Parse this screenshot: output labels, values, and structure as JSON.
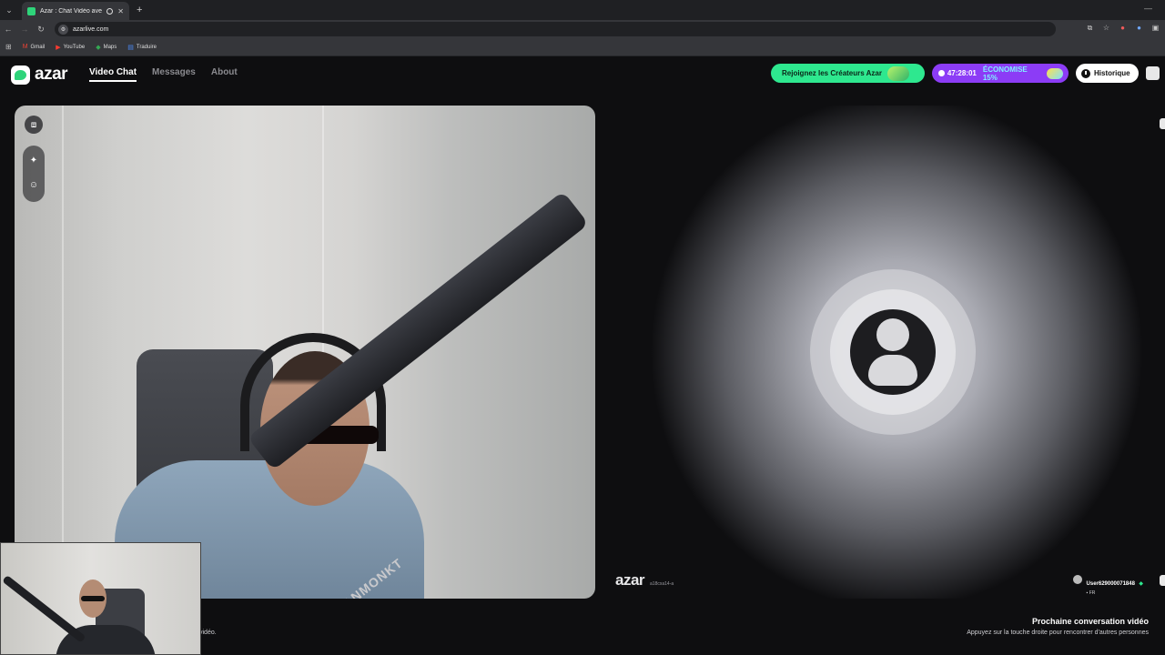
{
  "browser": {
    "tab_title": "Azar : Chat Vidéo avec de ...",
    "url": "azarlive.com",
    "bookmarks": [
      "Gmail",
      "YouTube",
      "Maps",
      "Traduire"
    ]
  },
  "header": {
    "logo": "azar",
    "nav": [
      {
        "label": "Video Chat",
        "active": true
      },
      {
        "label": "Messages",
        "active": false
      },
      {
        "label": "About",
        "active": false
      }
    ],
    "creators_button": "Rejoignez les Créateurs Azar",
    "timer": "47:28:01",
    "discount": "ÉCONOMISE 15%",
    "history_button": "Historique"
  },
  "self_video": {
    "mic_brand": "XANMONKT"
  },
  "partner": {
    "watermark": "azar",
    "watermark_id": "a18cxa14-a",
    "username": "User629000071848",
    "country": "FR"
  },
  "footer": {
    "next_title": "Prochaine conversation vidéo",
    "next_sub": "Appuyez sur la touche droite pour rencontrer d'autres personnes",
    "left_hint": "vidéo."
  },
  "colors": {
    "accent_green": "#2ee88f",
    "accent_purple": "#8c3cf6",
    "background": "#0e0e10"
  }
}
